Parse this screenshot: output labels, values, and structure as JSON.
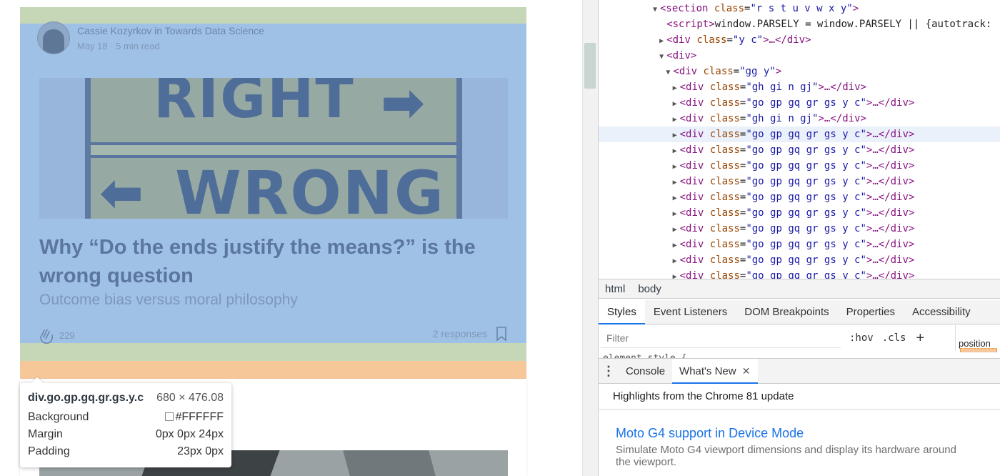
{
  "article": {
    "author_line": "Cassie Kozyrkov in Towards Data Science",
    "date_line": "May 18 · 5 min read",
    "hero_words": {
      "top": "RIGHT",
      "bottom": "WRONG",
      "arrow_right": "➡",
      "arrow_left": "⬅"
    },
    "title": "Why “Do the ends justify the means?” is the wrong question",
    "subtitle": "Outcome bias versus moral philosophy",
    "claps": "229",
    "responses": "2 responses"
  },
  "inspector_tooltip": {
    "selector": "div.go.gp.gq.gr.gs.y.c",
    "dimensions": "680 × 476.08",
    "rows": [
      {
        "label": "Background",
        "value": "#FFFFFF"
      },
      {
        "label": "Margin",
        "value": "0px 0px 24px"
      },
      {
        "label": "Padding",
        "value": "23px 0px"
      }
    ]
  },
  "highlight_colors": {
    "content": "#a0c1e6",
    "padding": "#c6d7b8",
    "margin": "#f6c799"
  },
  "dom_tree": [
    {
      "indent": 5,
      "tri": "▼",
      "tag": "section",
      "attr": "class",
      "val": "r s t u v w x y",
      "tail": ""
    },
    {
      "indent": 6,
      "tri": "",
      "tag": "script",
      "attr": "",
      "val": "",
      "tail": "window.PARSELY = window.PARSELY || {autotrack:"
    },
    {
      "indent": 6,
      "tri": "▶",
      "tag": "div",
      "attr": "class",
      "val": "y c",
      "tail": "…</div>"
    },
    {
      "indent": 6,
      "tri": "▼",
      "tag": "div",
      "attr": "",
      "val": "",
      "tail": ""
    },
    {
      "indent": 7,
      "tri": "▼",
      "tag": "div",
      "attr": "class",
      "val": "gg y",
      "tail": ""
    },
    {
      "indent": 8,
      "tri": "▶",
      "tag": "div",
      "attr": "class",
      "val": "gh gi n gj",
      "tail": "…</div>"
    },
    {
      "indent": 8,
      "tri": "▶",
      "tag": "div",
      "attr": "class",
      "val": "go gp gq gr gs y c",
      "tail": "…</div>"
    },
    {
      "indent": 8,
      "tri": "▶",
      "tag": "div",
      "attr": "class",
      "val": "gh gi n gj",
      "tail": "…</div>"
    },
    {
      "indent": 8,
      "tri": "▶",
      "tag": "div",
      "attr": "class",
      "val": "go gp gq gr gs y c",
      "tail": "…</div>",
      "hovered": true
    },
    {
      "indent": 8,
      "tri": "▶",
      "tag": "div",
      "attr": "class",
      "val": "go gp gq gr gs y c",
      "tail": "…</div>"
    },
    {
      "indent": 8,
      "tri": "▶",
      "tag": "div",
      "attr": "class",
      "val": "go gp gq gr gs y c",
      "tail": "…</div>"
    },
    {
      "indent": 8,
      "tri": "▶",
      "tag": "div",
      "attr": "class",
      "val": "go gp gq gr gs y c",
      "tail": "…</div>"
    },
    {
      "indent": 8,
      "tri": "▶",
      "tag": "div",
      "attr": "class",
      "val": "go gp gq gr gs y c",
      "tail": "…</div>"
    },
    {
      "indent": 8,
      "tri": "▶",
      "tag": "div",
      "attr": "class",
      "val": "go gp gq gr gs y c",
      "tail": "…</div>"
    },
    {
      "indent": 8,
      "tri": "▶",
      "tag": "div",
      "attr": "class",
      "val": "go gp gq gr gs y c",
      "tail": "…</div>"
    },
    {
      "indent": 8,
      "tri": "▶",
      "tag": "div",
      "attr": "class",
      "val": "go gp gq gr gs y c",
      "tail": "…</div>"
    },
    {
      "indent": 8,
      "tri": "▶",
      "tag": "div",
      "attr": "class",
      "val": "go gp gq gr gs y c",
      "tail": "…</div>"
    },
    {
      "indent": 8,
      "tri": "▶",
      "tag": "div",
      "attr": "class",
      "val": "go gp gq gr gs y c",
      "tail": "…</div>"
    }
  ],
  "breadcrumbs": [
    "html",
    "body"
  ],
  "panel_tabs": [
    "Styles",
    "Event Listeners",
    "DOM Breakpoints",
    "Properties",
    "Accessibility"
  ],
  "styles_toolbar": {
    "filter_placeholder": "Filter",
    "hov": ":hov",
    "cls": ".cls",
    "plus": "+",
    "computed_label": "position"
  },
  "styles_peek": "element.style {",
  "drawer": {
    "tabs": [
      "Console",
      "What's New"
    ],
    "close": "✕",
    "header": "Highlights from the Chrome 81 update",
    "item_title": "Moto G4 support in Device Mode",
    "item_desc": "Simulate Moto G4 viewport dimensions and display its hardware around the viewport."
  }
}
